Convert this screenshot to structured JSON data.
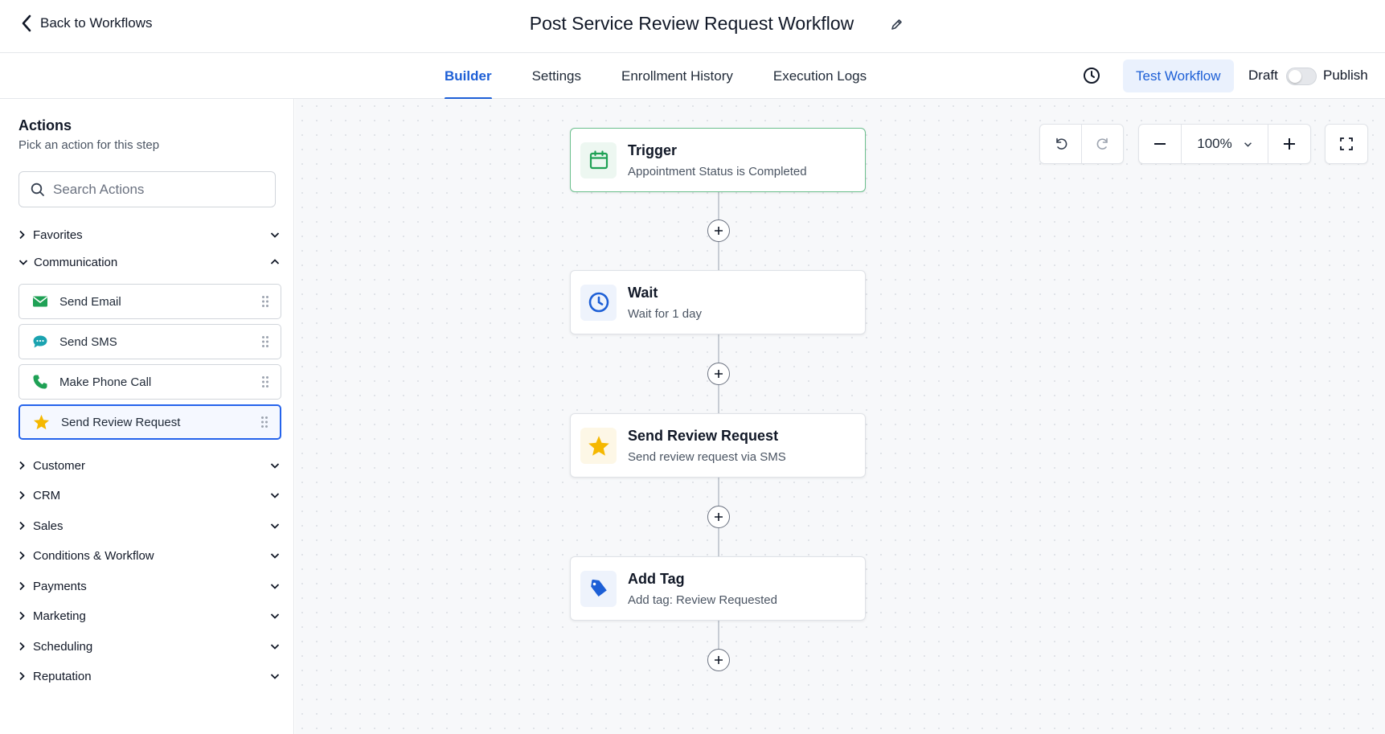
{
  "header": {
    "back_label": "Back to Workflows",
    "title": "Post Service Review Request Workflow"
  },
  "tabs": [
    {
      "label": "Builder",
      "active": true
    },
    {
      "label": "Settings",
      "active": false
    },
    {
      "label": "Enrollment History",
      "active": false
    },
    {
      "label": "Execution Logs",
      "active": false
    }
  ],
  "toolbar": {
    "test_label": "Test Workflow",
    "draft_label": "Draft",
    "publish_label": "Publish",
    "published": false
  },
  "sidebar": {
    "title": "Actions",
    "subtitle": "Pick an action for this step",
    "search_placeholder": "Search Actions",
    "categories": {
      "favorites": "Favorites",
      "communication": "Communication",
      "customer": "Customer",
      "crm": "CRM",
      "sales": "Sales",
      "conditions": "Conditions & Workflow",
      "payments": "Payments",
      "marketing": "Marketing",
      "scheduling": "Scheduling",
      "reputation": "Reputation"
    },
    "communication_actions": [
      {
        "label": "Send Email",
        "icon": "mail-icon"
      },
      {
        "label": "Send SMS",
        "icon": "chat-icon"
      },
      {
        "label": "Make Phone Call",
        "icon": "phone-icon"
      },
      {
        "label": "Send Review Request",
        "icon": "star-icon",
        "selected": true
      }
    ]
  },
  "canvas": {
    "zoom": "100%",
    "nodes": [
      {
        "title": "Trigger",
        "subtitle": "Appointment Status is Completed",
        "icon": "calendar-icon"
      },
      {
        "title": "Wait",
        "subtitle": "Wait for 1 day",
        "icon": "clock-icon"
      },
      {
        "title": "Send Review Request",
        "subtitle": "Send review request via SMS",
        "icon": "star-icon"
      },
      {
        "title": "Add Tag",
        "subtitle": "Add tag: Review Requested",
        "icon": "tag-icon"
      }
    ]
  },
  "colors": {
    "accent": "#1d5fd6",
    "trigger_border": "#6cc08e",
    "star": "#f5b800",
    "email_green": "#1fa155",
    "sms_teal": "#1aa3b0"
  }
}
